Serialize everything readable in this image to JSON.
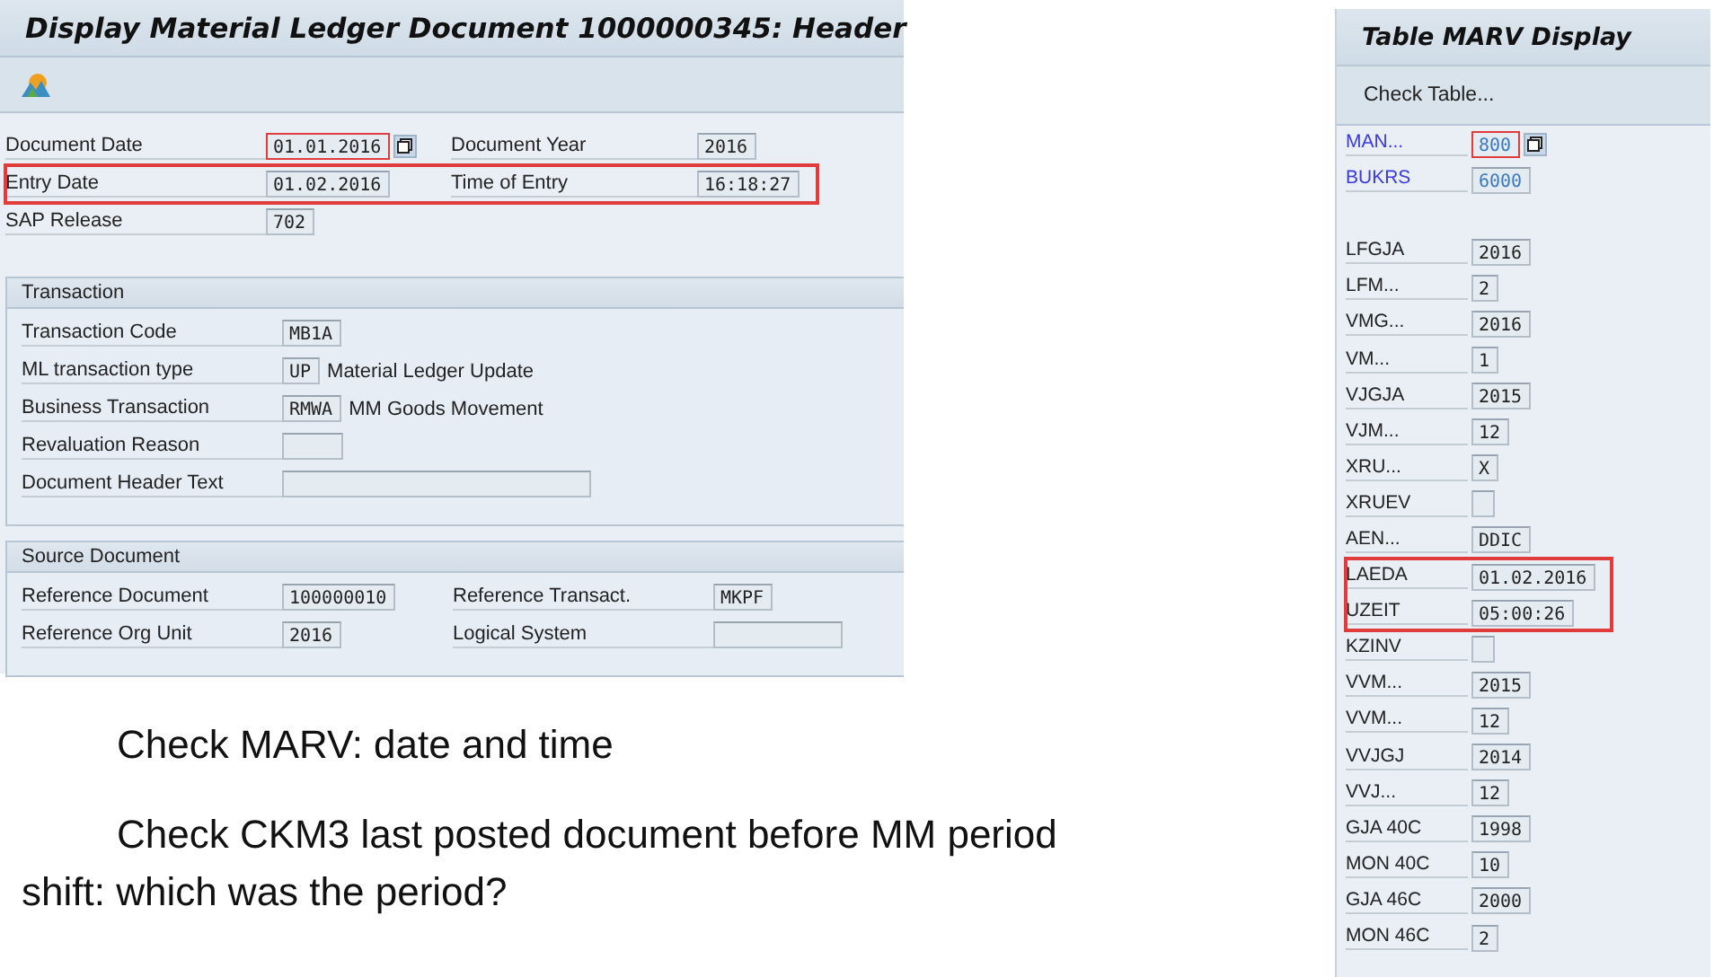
{
  "left_window": {
    "title": "Display Material Ledger Document 1000000345: Header",
    "header_rows": [
      {
        "highlighted": false,
        "cells": [
          {
            "label": "Document Date",
            "value": "01.01.2016",
            "focused": true
          },
          {
            "label": "Document Year",
            "value": "2016",
            "focused": false
          }
        ]
      },
      {
        "highlighted": true,
        "cells": [
          {
            "label": "Entry Date",
            "value": "01.02.2016",
            "focused": false
          },
          {
            "label": "Time of Entry",
            "value": "16:18:27",
            "focused": false
          }
        ]
      },
      {
        "highlighted": false,
        "cells": [
          {
            "label": "SAP Release",
            "value": "702",
            "focused": false
          }
        ]
      }
    ],
    "sections": [
      {
        "title": "Transaction",
        "rows": [
          {
            "cells": [
              {
                "label": "Transaction Code",
                "value": "MB1A"
              }
            ]
          },
          {
            "cells": [
              {
                "label": "ML transaction type",
                "value": "UP",
                "description": "Material Ledger Update"
              }
            ]
          },
          {
            "cells": [
              {
                "label": "Business Transaction",
                "value": "RMWA",
                "description": "MM Goods Movement"
              }
            ]
          },
          {
            "cells": [
              {
                "label": "Revaluation Reason",
                "kind": "short"
              }
            ]
          },
          {
            "cells": [
              {
                "label": "Document Header Text",
                "kind": "long"
              }
            ]
          }
        ]
      },
      {
        "title": "Source Document",
        "rows": [
          {
            "cells": [
              {
                "label": "Reference Document",
                "value": "100000010"
              },
              {
                "label": "Reference Transact.",
                "value": "MKPF"
              }
            ]
          },
          {
            "cells": [
              {
                "label": "Reference Org Unit",
                "value": "2016"
              },
              {
                "label": "Logical System",
                "kind": "medium"
              }
            ]
          }
        ]
      }
    ]
  },
  "notes": [
    "Check MARV: date and time",
    "Check CKM3 last posted document before MM period shift: which was the period?"
  ],
  "right_window": {
    "title": "Table MARV Display",
    "toolbar_button": "Check Table...",
    "groups": [
      {
        "highlighted": false,
        "rows": [
          {
            "label": "MAN...",
            "value": "800",
            "key": true,
            "focused": true
          },
          {
            "label": "BUKRS",
            "value": "6000",
            "key": true,
            "focused": false
          }
        ]
      },
      {
        "highlighted": false,
        "rows": [
          {
            "label": "LFGJA",
            "value": "2016",
            "key": false,
            "focused": false
          },
          {
            "label": "LFM...",
            "value": "2",
            "key": false,
            "focused": false
          },
          {
            "label": "VMG...",
            "value": "2016",
            "key": false,
            "focused": false
          },
          {
            "label": "VM...",
            "value": "1",
            "key": false,
            "focused": false
          },
          {
            "label": "VJGJA",
            "value": "2015",
            "key": false,
            "focused": false
          },
          {
            "label": "VJM...",
            "value": "12",
            "key": false,
            "focused": false
          },
          {
            "label": "XRU...",
            "value": "X",
            "key": false,
            "focused": false
          },
          {
            "label": "XRUEV",
            "kind": "flag",
            "key": false,
            "focused": false
          },
          {
            "label": "AEN...",
            "value": "DDIC",
            "key": false,
            "focused": false
          }
        ]
      },
      {
        "highlighted": true,
        "rows": [
          {
            "label": "LAEDA",
            "value": "01.02.2016",
            "key": false,
            "focused": false
          },
          {
            "label": "UZEIT",
            "value": "05:00:26",
            "key": false,
            "focused": false
          }
        ]
      },
      {
        "highlighted": false,
        "rows": [
          {
            "label": "KZINV",
            "kind": "flag",
            "key": false,
            "focused": false
          },
          {
            "label": "VVM...",
            "value": "2015",
            "key": false,
            "focused": false
          },
          {
            "label": "VVM...",
            "value": "12",
            "key": false,
            "focused": false
          },
          {
            "label": "VVJGJ",
            "value": "2014",
            "key": false,
            "focused": false
          },
          {
            "label": "VVJ...",
            "value": "12",
            "key": false,
            "focused": false
          },
          {
            "label": "GJA 40C",
            "value": "1998",
            "key": false,
            "focused": false
          },
          {
            "label": "MON 40C",
            "value": "10",
            "key": false,
            "focused": false
          },
          {
            "label": "GJA 46C",
            "value": "2000",
            "key": false,
            "focused": false
          },
          {
            "label": "MON 46C",
            "value": "2",
            "key": false,
            "focused": false
          }
        ]
      }
    ]
  }
}
